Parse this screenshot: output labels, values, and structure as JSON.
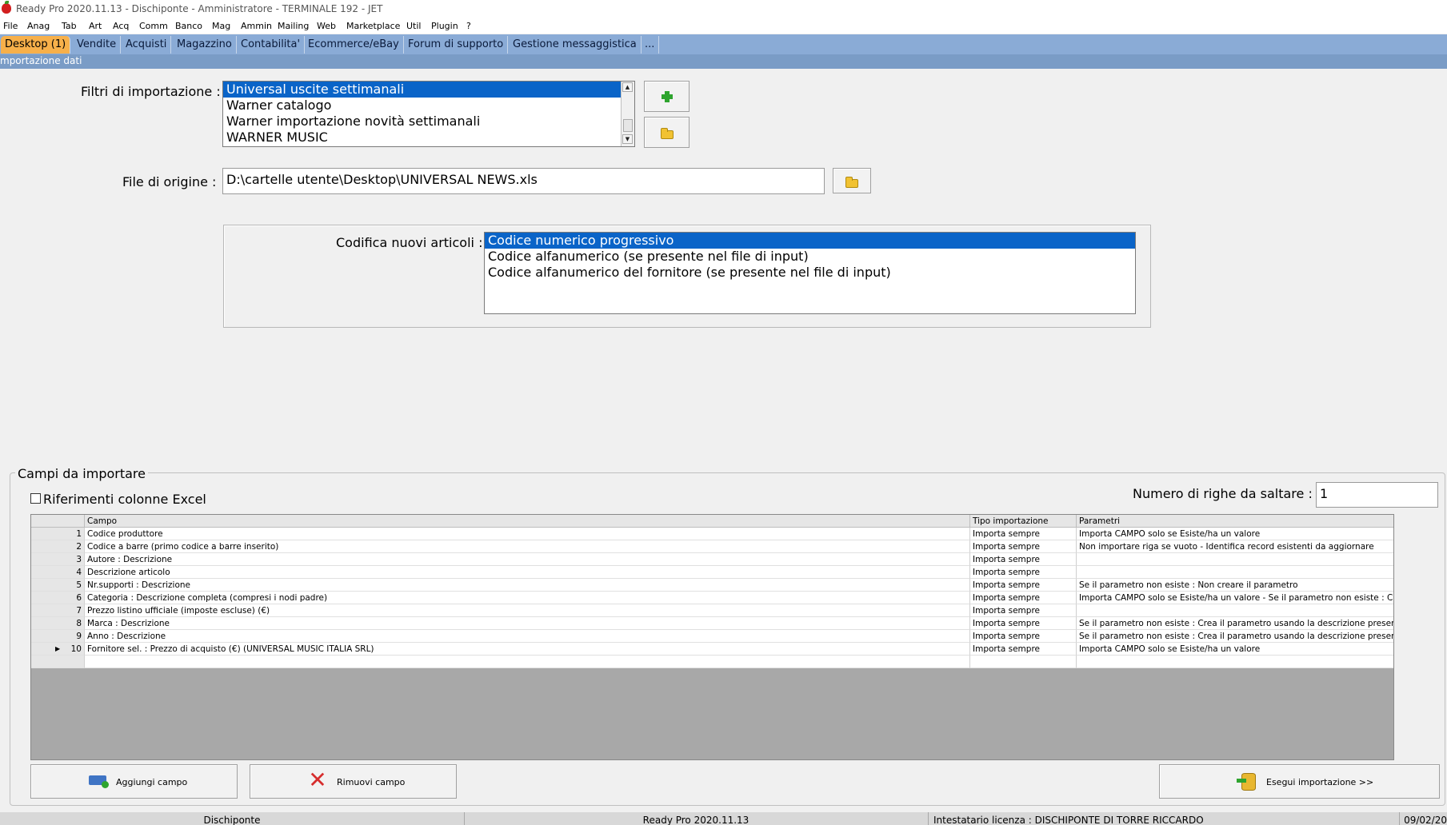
{
  "window": {
    "title": "Ready Pro 2020.11.13 - Dischiponte - Amministratore - TERMINALE 192 - JET"
  },
  "menu": [
    "File",
    "Anag",
    "Tab",
    "Art",
    "Acq",
    "Comm",
    "Banco",
    "Mag",
    "Ammin",
    "Mailing",
    "Web",
    "Marketplace",
    "Util",
    "Plugin",
    "?"
  ],
  "tabs": [
    "Desktop (1)",
    "Vendite",
    "Acquisti",
    "Magazzino",
    "Contabilita'",
    "Ecommerce/eBay",
    "Forum di supporto",
    "Gestione messaggistica",
    "..."
  ],
  "section_title": "mportazione dati",
  "filtri": {
    "label": "Filtri di importazione :",
    "items": [
      "Universal uscite settimanali",
      "Warner catalogo",
      "Warner importazione novità settimanali",
      "WARNER MUSIC"
    ],
    "selected": 0
  },
  "file_origine": {
    "label": "File di origine :",
    "value": "D:\\cartelle utente\\Desktop\\UNIVERSAL NEWS.xls"
  },
  "codifica": {
    "label": "Codifica nuovi articoli :",
    "items": [
      "Codice numerico progressivo",
      "Codice alfanumerico (se presente nel file di input)",
      "Codice alfanumerico del fornitore (se presente nel file di input)"
    ],
    "selected": 0
  },
  "campi": {
    "group_title": "Campi da importare",
    "checkbox_label": "Riferimenti colonne Excel",
    "righe_label": "Numero di righe da saltare  :",
    "righe_value": "1",
    "columns": [
      "Campo",
      "Tipo importazione",
      "Parametri"
    ],
    "rows": [
      {
        "n": "1",
        "campo": "Codice produttore",
        "tipo": "Importa sempre",
        "param": "Importa CAMPO solo se Esiste/ha un valore"
      },
      {
        "n": "2",
        "campo": "Codice a barre (primo codice a barre inserito)",
        "tipo": "Importa sempre",
        "param": "Non importare riga se vuoto - Identifica record esistenti da aggiornare"
      },
      {
        "n": "3",
        "campo": "Autore : Descrizione",
        "tipo": "Importa sempre",
        "param": ""
      },
      {
        "n": "4",
        "campo": "Descrizione articolo",
        "tipo": "Importa sempre",
        "param": ""
      },
      {
        "n": "5",
        "campo": "Nr.supporti : Descrizione",
        "tipo": "Importa sempre",
        "param": "Se il parametro non esiste : Non creare il parametro"
      },
      {
        "n": "6",
        "campo": "Categoria : Descrizione completa (compresi i nodi padre)",
        "tipo": "Importa sempre",
        "param": "Importa CAMPO solo se Esiste/ha un valore  - Se il parametro non esiste : Crea il parametro usando la descrizione presente nel file"
      },
      {
        "n": "7",
        "campo": "Prezzo listino ufficiale (imposte escluse) (€)",
        "tipo": "Importa sempre",
        "param": ""
      },
      {
        "n": "8",
        "campo": "Marca : Descrizione",
        "tipo": "Importa sempre",
        "param": "Se il parametro non esiste : Crea il parametro usando la descrizione presente nel file"
      },
      {
        "n": "9",
        "campo": "Anno : Descrizione",
        "tipo": "Importa sempre",
        "param": "Se il parametro non esiste : Crea il parametro usando la descrizione presente nel file"
      },
      {
        "n": "10",
        "campo": "Fornitore sel. : Prezzo di acquisto (€) (UNIVERSAL MUSIC ITALIA SRL)",
        "tipo": "Importa sempre",
        "param": "Importa CAMPO solo se Esiste/ha un valore"
      }
    ],
    "current_row_index": 9
  },
  "buttons": {
    "aggiungi": "Aggiungi campo",
    "rimuovi": "Rimuovi campo",
    "esegui": "Esegui importazione >>"
  },
  "status": [
    "Dischiponte",
    "Ready Pro 2020.11.13",
    "Intestatario licenza : DISCHIPONTE DI TORRE RICCARDO",
    "09/02/20"
  ]
}
